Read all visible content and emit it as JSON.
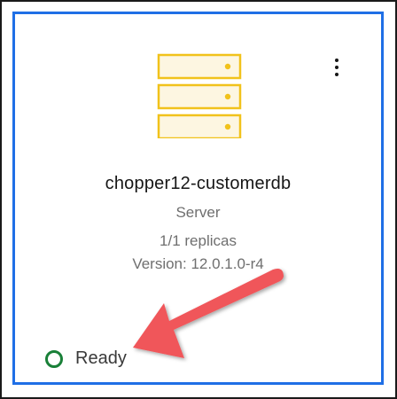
{
  "card": {
    "title": "chopper12-customerdb",
    "type": "Server",
    "replicas": "1/1 replicas",
    "version": "Version: 12.0.1.0-r4",
    "status": "Ready"
  },
  "colors": {
    "accent_border": "#1f6fe6",
    "server_icon_fill": "#fdf6e1",
    "server_icon_stroke": "#f1c21b",
    "status_ready": "#198038",
    "annotation_arrow": "#f0565a"
  },
  "icons": {
    "server": "server-icon",
    "menu": "overflow-menu-icon",
    "status": "status-ready-icon",
    "annotation": "annotation-arrow"
  }
}
